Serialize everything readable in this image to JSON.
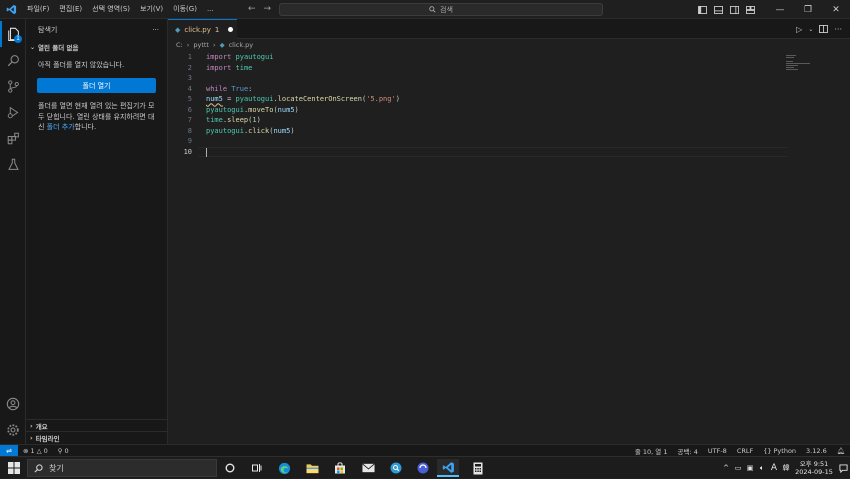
{
  "colors": {
    "accent": "#0078d4",
    "background": "#1f1f1f",
    "sidebar": "#181818",
    "modified_tab": "#e2c08d",
    "link": "#4daafc"
  },
  "titlebar": {
    "menus": [
      "파일(F)",
      "편집(E)",
      "선택 영역(S)",
      "보기(V)",
      "이동(G)",
      "..."
    ],
    "search_label": "검색"
  },
  "activity": {
    "explorer_badge": "1"
  },
  "sidebar": {
    "header": "탐색기",
    "more": "···",
    "section_no_folder": "열린 폴더 없음",
    "no_folder_msg": "아직 폴더를 열지 않았습니다.",
    "open_folder_btn": "폴더 열기",
    "desc_part1": "폴더를 열면 현재 열려 있는 편집기가 모두 닫힙니다. 열린 상태를 유지하려면 대신 ",
    "desc_link": "폴더 추가",
    "desc_part2": "합니다.",
    "outline": "개요",
    "timeline": "타임라인"
  },
  "editor": {
    "tab_name": "click.py",
    "tab_problem_count": "1",
    "breadcrumb_drive": "C:",
    "breadcrumb_folder": "pyttt",
    "breadcrumb_file": "click.py",
    "line_numbers": [
      "1",
      "2",
      "3",
      "4",
      "5",
      "6",
      "7",
      "8",
      "9",
      "10"
    ],
    "current_line": 10
  },
  "statusbar": {
    "errors": "1",
    "warnings": "0",
    "ports": "0",
    "position": "줄 10, 열 1",
    "spaces": "공백: 4",
    "encoding": "UTF-8",
    "eol": "CRLF",
    "language": "Python",
    "interpreter": "3.12.6"
  },
  "taskbar": {
    "search_placeholder": "찾기",
    "ime": "A",
    "ime2": "韓",
    "time": "오후 9:51",
    "date": "2024-09-15"
  }
}
